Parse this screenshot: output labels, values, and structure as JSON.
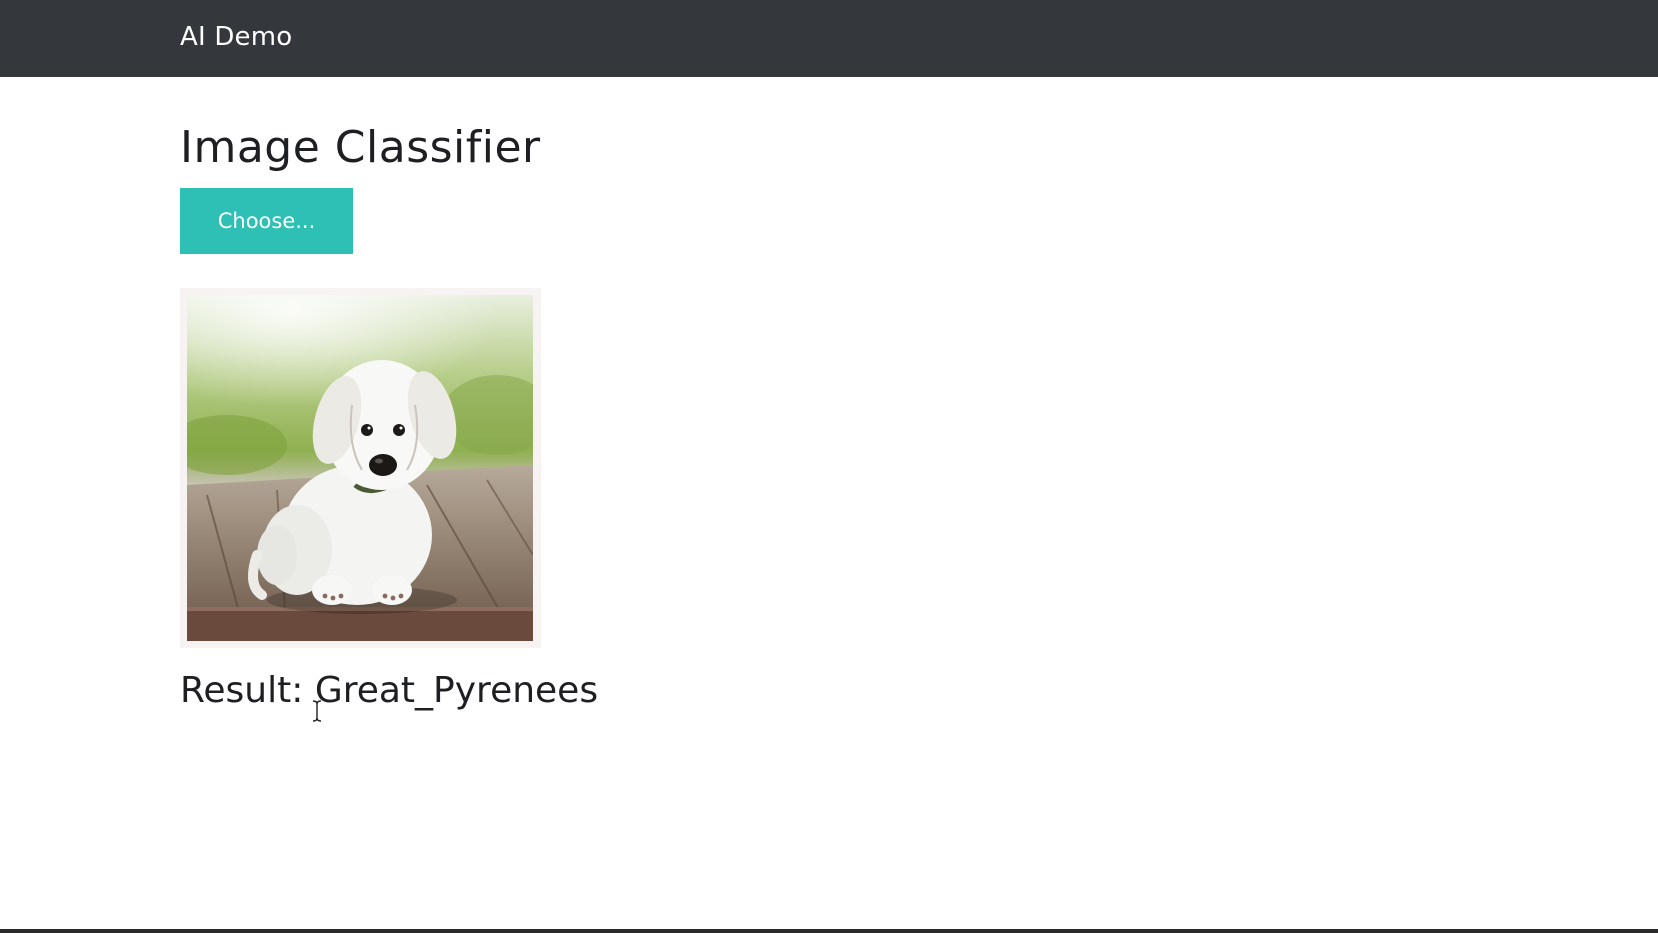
{
  "navbar": {
    "brand": "AI Demo"
  },
  "main": {
    "title": "Image Classifier",
    "choose_button_label": "Choose...",
    "preview_image": "puppy-photo",
    "result_label": "Result: ",
    "result_value": "Great_Pyrenees"
  },
  "colors": {
    "navbar_bg": "#34373c",
    "button_bg": "#2ebfb5",
    "text": "#1e1f22"
  }
}
